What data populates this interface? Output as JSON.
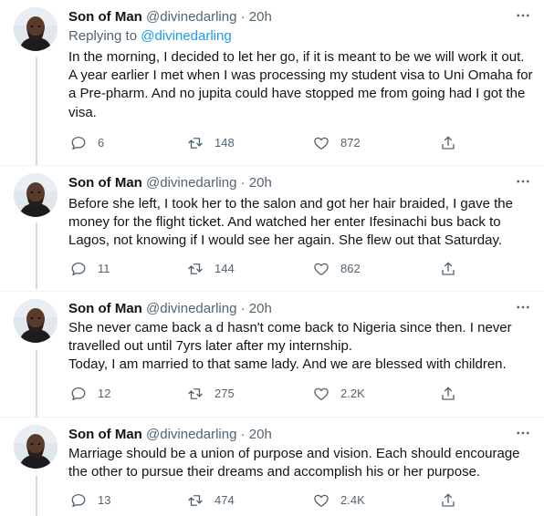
{
  "thread": {
    "tweets": [
      {
        "name": "Son of Man",
        "handle": "@divinedarling",
        "time": "· 20h",
        "replying_prefix": "Replying to ",
        "replying_to": "@divinedarling",
        "text": "In the morning, I decided to let her go, if it is meant to be we will work it out.\nA year earlier I met when I was processing my student visa to Uni Omaha for\na Pre-pharm. And no jupita could have stopped me from going had I got the\nvisa.",
        "replies": "6",
        "retweets": "148",
        "likes": "872"
      },
      {
        "name": "Son of Man",
        "handle": "@divinedarling",
        "time": "· 20h",
        "text": "Before she left, I took her to the salon and got her hair braided, I gave  the\nmoney for the flight ticket. And watched her enter Ifesinachi bus back to\nLagos,  not knowing if I would see her again. She flew out that Saturday.",
        "replies": "11",
        "retweets": "144",
        "likes": "862"
      },
      {
        "name": "Son of Man",
        "handle": "@divinedarling",
        "time": "· 20h",
        "text": "She never came back a d hasn't come back to Nigeria since then. I never\ntravelled out until 7yrs later after my internship.\nToday, I am married to that same lady. And we are blessed with children.",
        "replies": "12",
        "retweets": "275",
        "likes": "2.2K"
      },
      {
        "name": "Son of Man",
        "handle": "@divinedarling",
        "time": "· 20h",
        "text": "Marriage should be a union  of purpose and vision. Each should encourage\nthe other to pursue their dreams and accomplish his or her purpose.",
        "replies": "13",
        "retweets": "474",
        "likes": "2.4K"
      }
    ]
  },
  "icons": {
    "more": "more-horizontal-icon",
    "reply": "reply-bubble-icon",
    "retweet": "retweet-icon",
    "like": "heart-icon",
    "share": "share-icon"
  },
  "colors": {
    "text": "#0f1419",
    "secondary": "#536471",
    "link": "#1d9bf0",
    "thread_line": "#cfd9de",
    "divider": "#eff3f4"
  }
}
